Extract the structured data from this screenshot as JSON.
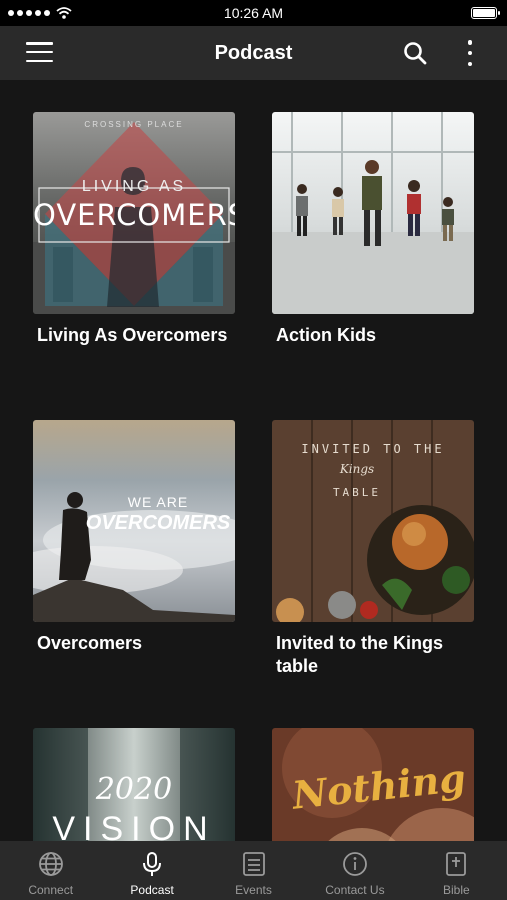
{
  "status": {
    "time": "10:26 AM"
  },
  "header": {
    "title": "Podcast"
  },
  "podcasts": [
    {
      "title": "Living As Overcomers",
      "art_small_text": "CROSSING PLACE",
      "art_line1": "LIVING AS",
      "art_line2": "OVERCOMERS"
    },
    {
      "title": "Action Kids"
    },
    {
      "title": "Overcomers",
      "art_line1": "WE ARE",
      "art_line2": "OVERCOMERS"
    },
    {
      "title": "Invited to the Kings table",
      "art_line1": "INVITED TO THE",
      "art_line2": "Kings",
      "art_line3": "TABLE"
    },
    {
      "title": "",
      "art_line1": "2020",
      "art_line2": "VISION"
    },
    {
      "title": "",
      "art_line1": "Nothing"
    }
  ],
  "tabs": [
    {
      "label": "Connect",
      "icon": "globe-icon"
    },
    {
      "label": "Podcast",
      "icon": "microphone-icon",
      "active": true
    },
    {
      "label": "Events",
      "icon": "events-icon"
    },
    {
      "label": "Contact Us",
      "icon": "info-icon"
    },
    {
      "label": "Bible",
      "icon": "bible-icon"
    }
  ]
}
